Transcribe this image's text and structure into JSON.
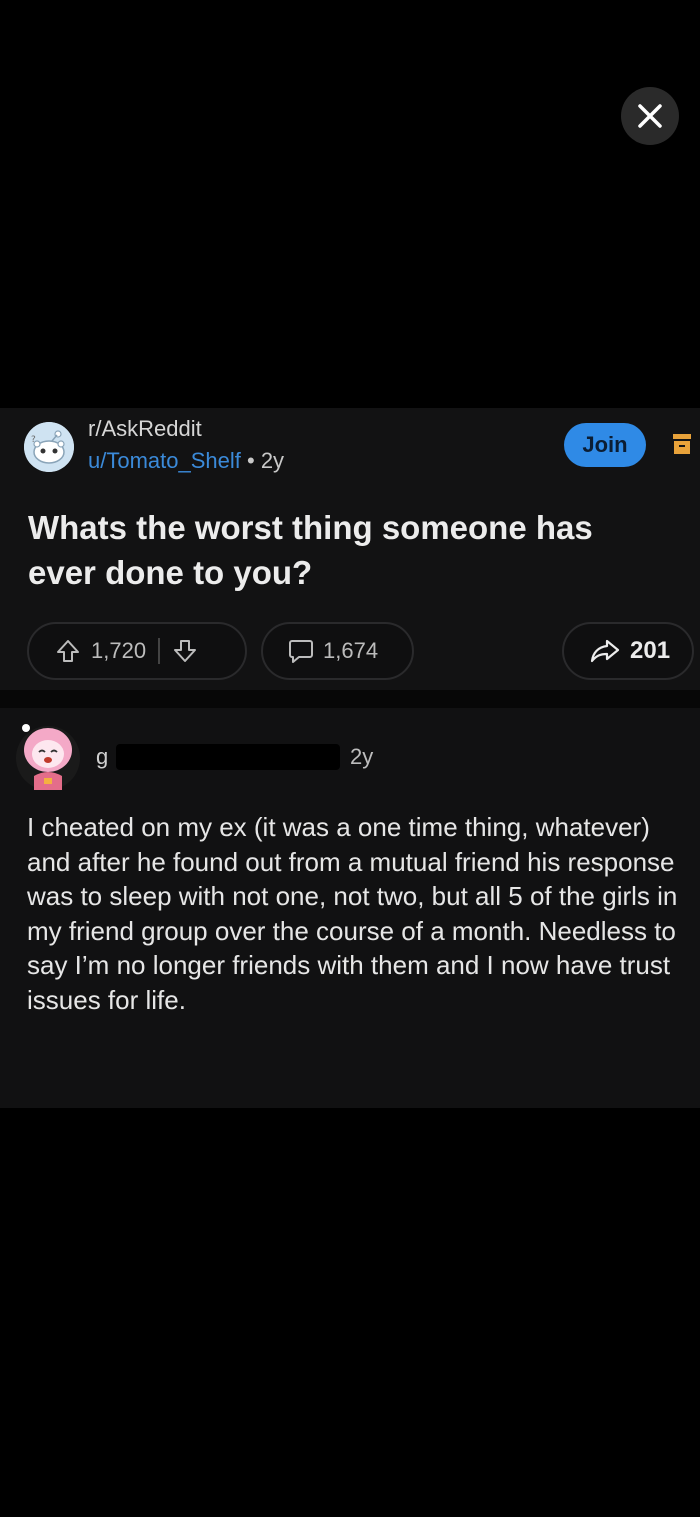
{
  "viewer": {
    "close_icon": "close-icon"
  },
  "post": {
    "subreddit": "r/AskReddit",
    "author": "u/Tomato_Shelf",
    "separator": " • ",
    "age": "2y",
    "join_label": "Join",
    "title": "Whats the worst thing someone has ever done to you?",
    "upvotes": "1,720",
    "comments": "1,674",
    "shares": "201"
  },
  "comment": {
    "user_visible": "g",
    "age": "2y",
    "body": "I cheated on my ex (it was a one time thing, whatever) and after he found out from a mutual friend his response was to sleep with not one, not two, but all 5 of the girls in my friend group over the course of a month. Needless to say I’m no longer friends with them and I now have trust issues for life."
  },
  "colors": {
    "background": "#000000",
    "card": "#121213",
    "join_blue": "#2f8ae6",
    "username_blue": "#3b8ad9",
    "menu_orange": "#e8a23a"
  }
}
